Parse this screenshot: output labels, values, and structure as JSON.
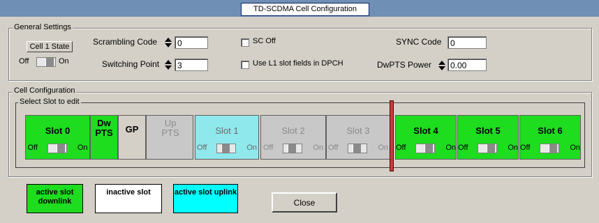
{
  "window": {
    "title": "TD-SCDMA Cell Configuration"
  },
  "general": {
    "legend": "General Settings",
    "cell_state_button": "Cell 1 State",
    "off": "Off",
    "on": "On",
    "scrambling_label": "Scrambling Code",
    "scrambling_value": "0",
    "switching_label": "Switching Point",
    "switching_value": "3",
    "sc_off_label": "SC Off",
    "l1_label": "Use L1 slot fields in DPCH",
    "sync_label": "SYNC Code",
    "sync_value": "0",
    "dwpts_label": "DwPTS Power",
    "dwpts_value": "0.00"
  },
  "cellconfig": {
    "legend": "Cell Configuration",
    "sub_legend": "Select Slot to edit",
    "slots": [
      {
        "name": "Slot 0",
        "off": "Off",
        "on": "On",
        "state": "active-downlink"
      },
      {
        "name": "Dw PTS"
      },
      {
        "name": "GP"
      },
      {
        "name": "Up PTS"
      },
      {
        "name": "Slot 1",
        "off": "Off",
        "on": "On",
        "state": "active-uplink"
      },
      {
        "name": "Slot 2",
        "off": "Off",
        "on": "On",
        "state": "inactive"
      },
      {
        "name": "Slot 3",
        "off": "Off",
        "on": "On",
        "state": "inactive"
      },
      {
        "name": "Slot 4",
        "off": "Off",
        "on": "On",
        "state": "active-downlink"
      },
      {
        "name": "Slot 5",
        "off": "Off",
        "on": "On",
        "state": "active-downlink"
      },
      {
        "name": "Slot 6",
        "off": "Off",
        "on": "On",
        "state": "active-downlink"
      }
    ]
  },
  "legend_keys": {
    "active_downlink": "active slot downlink",
    "inactive": "inactive slot",
    "active_uplink": "active slot uplink"
  },
  "close_label": "Close",
  "colors": {
    "downlink": "#1edc1e",
    "uplink": "#8fe8ec",
    "inactive": "#c8c8c8",
    "switch_marker": "#c83c3c"
  }
}
